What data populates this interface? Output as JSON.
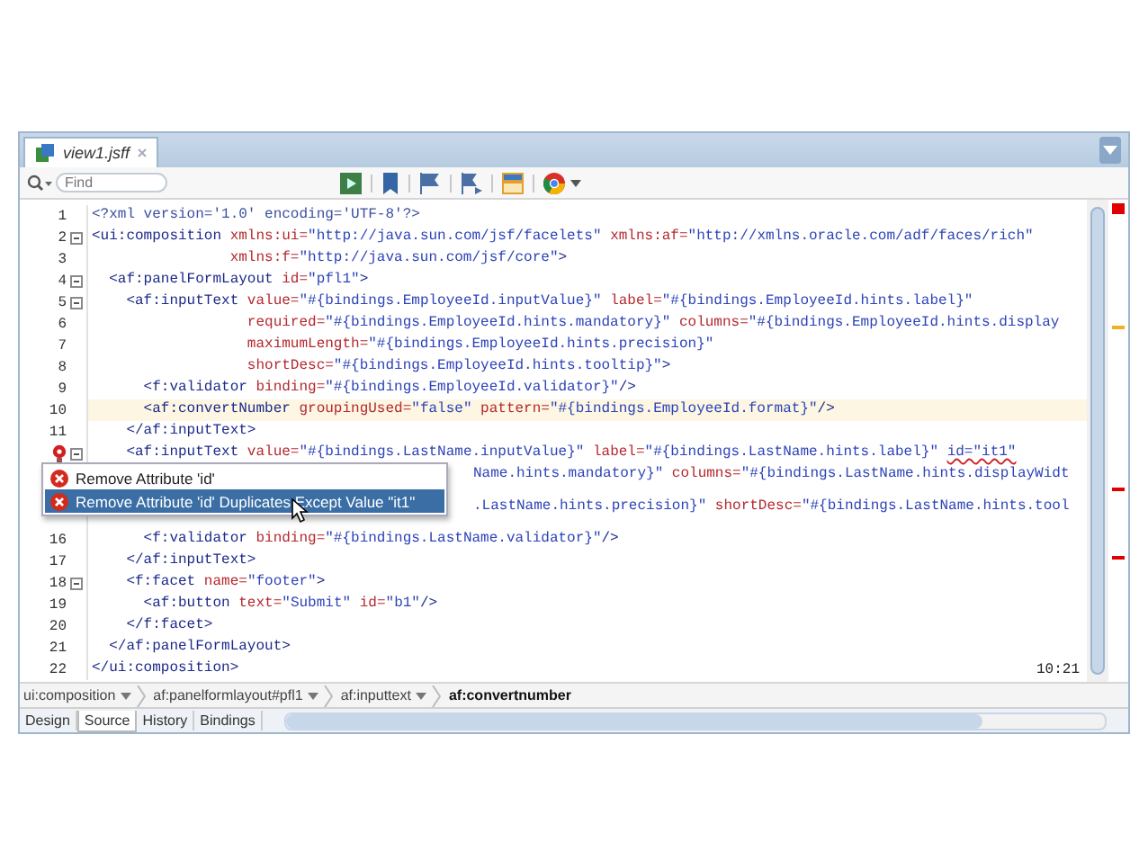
{
  "tab": {
    "title": "view1.jsff",
    "selected": true
  },
  "search": {
    "placeholder": "Find"
  },
  "lines": [
    {
      "number": "1",
      "tokens": [
        {
          "kind": "pi",
          "text": "<?xml version='1.0' encoding='UTF-8'?>"
        }
      ]
    },
    {
      "number": "2",
      "fold": true,
      "tokens": [
        {
          "kind": "tag",
          "text": "<ui:composition "
        },
        {
          "kind": "attr",
          "text": "xmlns:ui="
        },
        {
          "kind": "value",
          "text": "\"http://java.sun.com/jsf/facelets\" "
        },
        {
          "kind": "attr",
          "text": "xmlns:af="
        },
        {
          "kind": "value",
          "text": "\"http://xmlns.oracle.com/adf/faces/rich\""
        }
      ]
    },
    {
      "number": "3",
      "tokens": [
        {
          "kind": "attr",
          "text": "                xmlns:f="
        },
        {
          "kind": "value",
          "text": "\"http://java.sun.com/jsf/core\""
        },
        {
          "kind": "tag",
          "text": ">"
        }
      ]
    },
    {
      "number": "4",
      "fold": true,
      "tokens": [
        {
          "kind": "tag",
          "text": "  <af:panelFormLayout "
        },
        {
          "kind": "attr",
          "text": "id="
        },
        {
          "kind": "value",
          "text": "\"pfl1\""
        },
        {
          "kind": "tag",
          "text": ">"
        }
      ]
    },
    {
      "number": "5",
      "fold": true,
      "tokens": [
        {
          "kind": "tag",
          "text": "    <af:inputText "
        },
        {
          "kind": "attr",
          "text": "value="
        },
        {
          "kind": "value",
          "text": "\"#{bindings.EmployeeId.inputValue}\" "
        },
        {
          "kind": "attr",
          "text": "label="
        },
        {
          "kind": "value",
          "text": "\"#{bindings.EmployeeId.hints.label}\""
        }
      ]
    },
    {
      "number": "6",
      "tokens": [
        {
          "kind": "attr",
          "text": "                  required="
        },
        {
          "kind": "value",
          "text": "\"#{bindings.EmployeeId.hints.mandatory}\" "
        },
        {
          "kind": "attr",
          "text": "columns="
        },
        {
          "kind": "value",
          "text": "\"#{bindings.EmployeeId.hints.display"
        }
      ]
    },
    {
      "number": "7",
      "tokens": [
        {
          "kind": "attr",
          "text": "                  maximumLength="
        },
        {
          "kind": "value",
          "text": "\"#{bindings.EmployeeId.hints.precision}\""
        }
      ]
    },
    {
      "number": "8",
      "tokens": [
        {
          "kind": "attr",
          "text": "                  shortDesc="
        },
        {
          "kind": "value",
          "text": "\"#{bindings.EmployeeId.hints.tooltip}\""
        },
        {
          "kind": "tag",
          "text": ">"
        }
      ]
    },
    {
      "number": "9",
      "tokens": [
        {
          "kind": "tag",
          "text": "      <f:validator "
        },
        {
          "kind": "attr",
          "text": "binding="
        },
        {
          "kind": "value",
          "text": "\"#{bindings.EmployeeId.validator}\""
        },
        {
          "kind": "tag",
          "text": "/>"
        }
      ]
    },
    {
      "number": "10",
      "highlighted": true,
      "tokens": [
        {
          "kind": "tag",
          "text": "      <af:convertNumber "
        },
        {
          "kind": "attr",
          "text": "groupingUsed="
        },
        {
          "kind": "value",
          "text": "\"false\" "
        },
        {
          "kind": "attr",
          "text": "pattern="
        },
        {
          "kind": "value",
          "text": "\"#{bindings.EmployeeId.format}\""
        },
        {
          "kind": "tag",
          "text": "/>"
        }
      ]
    },
    {
      "number": "11",
      "tokens": [
        {
          "kind": "tag",
          "text": "    </af:inputText>"
        }
      ]
    },
    {
      "error": true,
      "fold": true,
      "tokens": [
        {
          "kind": "tag",
          "text": "    <af:inputText "
        },
        {
          "kind": "attr",
          "text": "value="
        },
        {
          "kind": "value",
          "text": "\"#{bindings.LastName.inputValue}\" "
        },
        {
          "kind": "attr",
          "text": "label="
        },
        {
          "kind": "value",
          "text": "\"#{bindings.LastName.hints.label}\" "
        },
        {
          "kind": "error",
          "text": "id=\"it1\""
        }
      ]
    },
    {
      "tokens": [
        {
          "kind": "value",
          "text": "Name.hints.mandatory}\" "
        },
        {
          "kind": "attr",
          "text": "columns="
        },
        {
          "kind": "value",
          "text": "\"#{bindings.LastName.hints.displayWidt"
        }
      ]
    },
    {
      "tokens": [
        {
          "kind": "value",
          "text": ".LastName.hints.precision}\" "
        },
        {
          "kind": "attr",
          "text": "shortDesc="
        },
        {
          "kind": "value",
          "text": "\"#{bindings.LastName.hints.tool"
        }
      ]
    },
    {
      "number": "16",
      "tokens": [
        {
          "kind": "tag",
          "text": "      <f:validator "
        },
        {
          "kind": "attr",
          "text": "binding="
        },
        {
          "kind": "value",
          "text": "\"#{bindings.LastName.validator}\""
        },
        {
          "kind": "tag",
          "text": "/>"
        }
      ]
    },
    {
      "number": "17",
      "tokens": [
        {
          "kind": "tag",
          "text": "    </af:inputText>"
        }
      ]
    },
    {
      "number": "18",
      "fold": true,
      "tokens": [
        {
          "kind": "tag",
          "text": "    <f:facet "
        },
        {
          "kind": "attr",
          "text": "name="
        },
        {
          "kind": "value",
          "text": "\"footer\""
        },
        {
          "kind": "tag",
          "text": ">"
        }
      ]
    },
    {
      "number": "19",
      "tokens": [
        {
          "kind": "tag",
          "text": "      <af:button "
        },
        {
          "kind": "attr",
          "text": "text="
        },
        {
          "kind": "value",
          "text": "\"Submit\" "
        },
        {
          "kind": "attr",
          "text": "id="
        },
        {
          "kind": "value",
          "text": "\"b1\""
        },
        {
          "kind": "tag",
          "text": "/>"
        }
      ]
    },
    {
      "number": "20",
      "tokens": [
        {
          "kind": "tag",
          "text": "    </f:facet>"
        }
      ]
    },
    {
      "number": "21",
      "tokens": [
        {
          "kind": "tag",
          "text": "  </af:panelFormLayout>"
        }
      ]
    },
    {
      "number": "22",
      "tokens": [
        {
          "kind": "tag",
          "text": "</ui:composition>"
        }
      ]
    }
  ],
  "quick_fix_menu": [
    {
      "label": "Remove Attribute 'id'",
      "selected": false
    },
    {
      "label": "Remove Attribute 'id' Duplicates Except Value \"it1\"",
      "selected": true
    }
  ],
  "overview_marks": [
    {
      "color": "#e00000"
    },
    {
      "color": "#f0b020"
    },
    {
      "color": "#e00000"
    },
    {
      "color": "#e00000"
    }
  ],
  "cursor_position": "10:21",
  "breadcrumbs": [
    {
      "label": "ui:composition",
      "selected": false
    },
    {
      "label": "af:panelformlayout#pfl1",
      "selected": false
    },
    {
      "label": "af:inputtext",
      "selected": false
    },
    {
      "label": "af:convertnumber",
      "selected": true
    }
  ],
  "editor_tabs": [
    {
      "label": "Design",
      "selected": false
    },
    {
      "label": "Source",
      "selected": true
    },
    {
      "label": "History",
      "selected": false
    },
    {
      "label": "Bindings",
      "selected": false
    }
  ]
}
